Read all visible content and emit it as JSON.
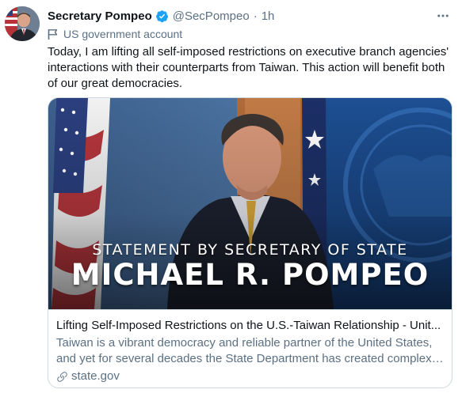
{
  "author": {
    "display_name": "Secretary Pompeo",
    "handle": "@SecPompeo",
    "separator": "·",
    "time": "1h",
    "verified": true
  },
  "label": {
    "text": "US government account",
    "icon": "flag-icon"
  },
  "tweet": {
    "text": "Today, I am lifting all self-imposed restrictions on executive branch agencies' interactions with their counterparts from Taiwan. This action will benefit both of our great democracies."
  },
  "card": {
    "image_subtitle": "STATEMENT BY SECRETARY OF STATE",
    "image_title": "MICHAEL R. POMPEO",
    "title": "Lifting Self-Imposed Restrictions on the U.S.-Taiwan Relationship - Unit...",
    "description_line1": "Taiwan is a vibrant democracy and reliable partner of the United States,",
    "description_line2": "and yet for several decades the State Department has created complex ...",
    "domain": "state.gov",
    "domain_icon": "link-icon"
  },
  "colors": {
    "text_primary": "#0f1419",
    "text_secondary": "#5b7083",
    "verified_blue": "#1da1f2",
    "border": "#cfd9de",
    "card_bg_blue": "#1f4f8e"
  }
}
